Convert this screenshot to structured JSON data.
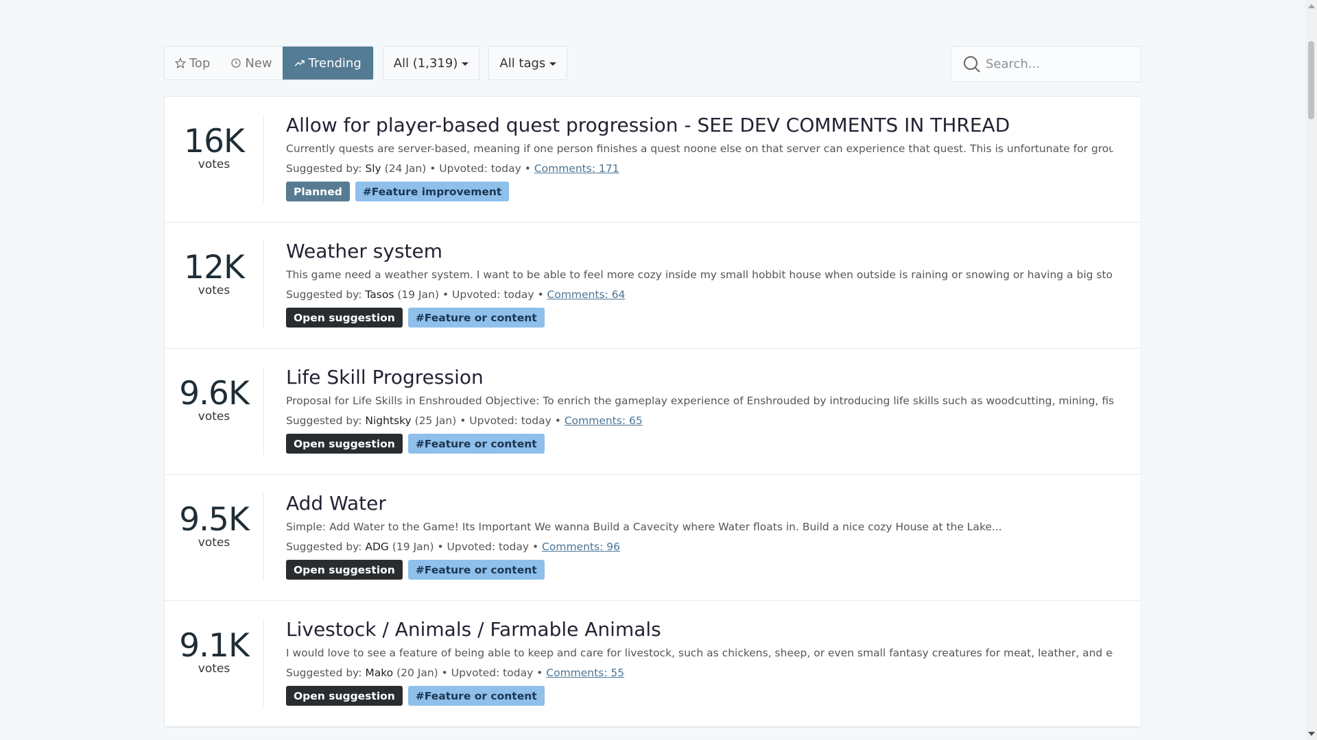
{
  "toolbar": {
    "tabs": [
      {
        "label": "Top",
        "icon": "star-icon",
        "active": false
      },
      {
        "label": "New",
        "icon": "clock-icon",
        "active": false
      },
      {
        "label": "Trending",
        "icon": "trending-icon",
        "active": true
      }
    ],
    "filter_label": "All (1,319)",
    "tags_label": "All tags",
    "search_placeholder": "Search..."
  },
  "colors": {
    "accent": "#547b94",
    "open_tag": "#2a2d30",
    "hash_tag": "#8fc0ec"
  },
  "suggestions": [
    {
      "votes": "16K",
      "votes_label": "votes",
      "title": "Allow for player-based quest progression - SEE DEV COMMENTS IN THREAD",
      "description": "Currently quests are server-based, meaning if one person finishes a quest noone else on that server can experience that quest. This is unfortunate for groups who may ...",
      "suggested_by_label": "Suggested by:",
      "author": "Sly",
      "date": "(24 Jan)",
      "upvoted": "• Upvoted: today •",
      "comments": "Comments: 171",
      "status": "Planned",
      "tag": "#Feature improvement"
    },
    {
      "votes": "12K",
      "votes_label": "votes",
      "title": "Weather system",
      "description": "This game need a weather system. I want to be able to feel more cozy inside my small hobbit house when outside is raining or snowing or having a big storm.. The game ...",
      "suggested_by_label": "Suggested by:",
      "author": "Tasos",
      "date": "(19 Jan)",
      "upvoted": "• Upvoted: today •",
      "comments": "Comments: 64",
      "status": "Open suggestion",
      "tag": "#Feature or content"
    },
    {
      "votes": "9.6K",
      "votes_label": "votes",
      "title": "Life Skill Progression",
      "description": "Proposal for Life Skills in Enshrouded Objective: To enrich the gameplay experience of Enshrouded by introducing life skills such as woodcutting, mining, fishing, ...",
      "suggested_by_label": "Suggested by:",
      "author": "Nightsky",
      "date": "(25 Jan)",
      "upvoted": "• Upvoted: today •",
      "comments": "Comments: 65",
      "status": "Open suggestion",
      "tag": "#Feature or content"
    },
    {
      "votes": "9.5K",
      "votes_label": "votes",
      "title": "Add Water",
      "description": "Simple: Add Water to the Game! Its Important We wanna Build a Cavecity where Water floats in. Build a nice cozy House at the Lake...",
      "suggested_by_label": "Suggested by:",
      "author": "ADG",
      "date": "(19 Jan)",
      "upvoted": "• Upvoted: today •",
      "comments": "Comments: 96",
      "status": "Open suggestion",
      "tag": "#Feature or content"
    },
    {
      "votes": "9.1K",
      "votes_label": "votes",
      "title": "Livestock / Animals / Farmable Animals",
      "description": "I would love to see a feature of being able to keep and care for livestock, such as chickens, sheep, or even small fantasy creatures for meat, leather, and eggs. To ...",
      "suggested_by_label": "Suggested by:",
      "author": "Mako",
      "date": "(20 Jan)",
      "upvoted": "• Upvoted: today •",
      "comments": "Comments: 55",
      "status": "Open suggestion",
      "tag": "#Feature or content"
    }
  ]
}
